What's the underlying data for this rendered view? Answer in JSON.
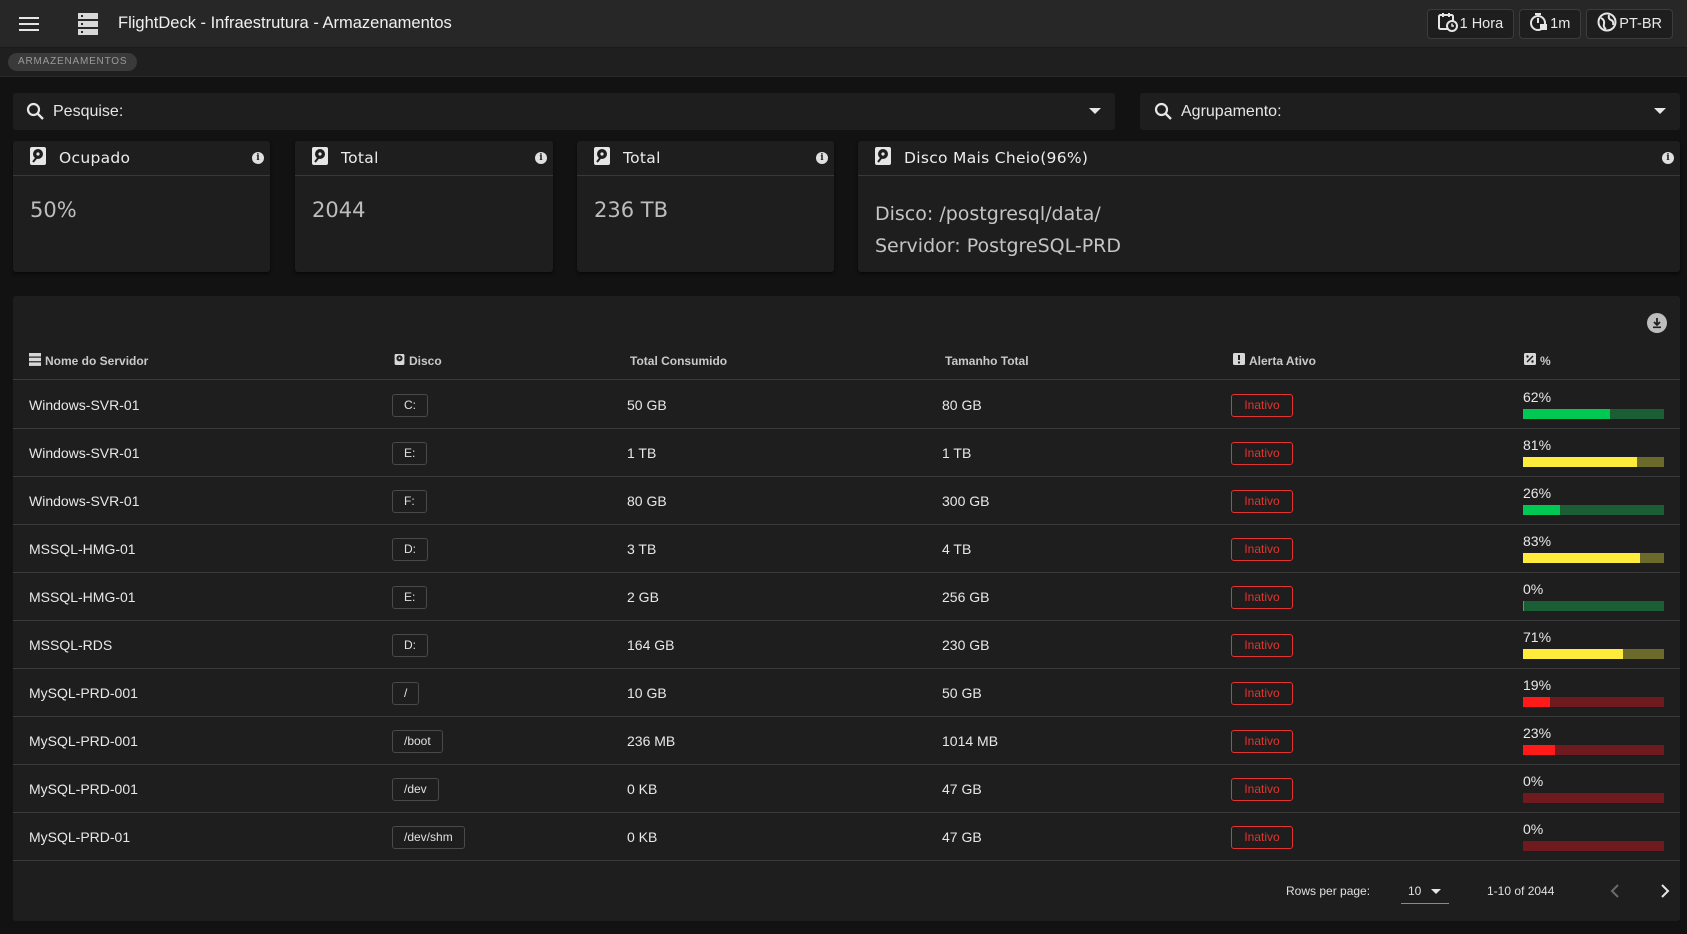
{
  "topbar": {
    "title": "FlightDeck - Infraestrutura - Armazenamentos",
    "time_range": "1 Hora",
    "refresh": "1m",
    "language": "PT-BR"
  },
  "breadcrumb": {
    "chip": "ARMAZENAMENTOS"
  },
  "filters": {
    "search_label": "Pesquise:",
    "group_label": "Agrupamento:"
  },
  "cards": [
    {
      "title": "Ocupado",
      "value": "50%"
    },
    {
      "title": "Total",
      "value": "2044"
    },
    {
      "title": "Total",
      "value": "236 TB"
    },
    {
      "title": "Disco Mais Cheio(96%)",
      "line1": "Disco: /postgresql/data/",
      "line2": "Servidor: PostgreSQL-PRD"
    }
  ],
  "table": {
    "headers": {
      "server": "Nome do Servidor",
      "disk": "Disco",
      "consumed": "Total Consumido",
      "size": "Tamanho Total",
      "alert": "Alerta Ativo",
      "pct": "%"
    },
    "rows": [
      {
        "server": "Windows-SVR-01",
        "disk": "C:",
        "consumed": "50 GB",
        "size": "80 GB",
        "alert": "Inativo",
        "pct_label": "62%",
        "pct": 62,
        "color": "green"
      },
      {
        "server": "Windows-SVR-01",
        "disk": "E:",
        "consumed": "1 TB",
        "size": "1 TB",
        "alert": "Inativo",
        "pct_label": "81%",
        "pct": 81,
        "color": "yellow"
      },
      {
        "server": "Windows-SVR-01",
        "disk": "F:",
        "consumed": "80 GB",
        "size": "300 GB",
        "alert": "Inativo",
        "pct_label": "26%",
        "pct": 26,
        "color": "green"
      },
      {
        "server": "MSSQL-HMG-01",
        "disk": "D:",
        "consumed": "3 TB",
        "size": "4 TB",
        "alert": "Inativo",
        "pct_label": "83%",
        "pct": 83,
        "color": "yellow"
      },
      {
        "server": "MSSQL-HMG-01",
        "disk": "E:",
        "consumed": "2 GB",
        "size": "256 GB",
        "alert": "Inativo",
        "pct_label": "0%",
        "pct": 0,
        "color": "green"
      },
      {
        "server": "MSSQL-RDS",
        "disk": "D:",
        "consumed": "164 GB",
        "size": "230 GB",
        "alert": "Inativo",
        "pct_label": "71%",
        "pct": 71,
        "color": "yellow"
      },
      {
        "server": "MySQL-PRD-001",
        "disk": "/",
        "consumed": "10 GB",
        "size": "50 GB",
        "alert": "Inativo",
        "pct_label": "19%",
        "pct": 19,
        "color": "red"
      },
      {
        "server": "MySQL-PRD-001",
        "disk": "/boot",
        "consumed": "236 MB",
        "size": "1014 MB",
        "alert": "Inativo",
        "pct_label": "23%",
        "pct": 23,
        "color": "red"
      },
      {
        "server": "MySQL-PRD-001",
        "disk": "/dev",
        "consumed": "0 KB",
        "size": "47 GB",
        "alert": "Inativo",
        "pct_label": "0%",
        "pct": 0,
        "color": "red"
      },
      {
        "server": "MySQL-PRD-01",
        "disk": "/dev/shm",
        "consumed": "0 KB",
        "size": "47 GB",
        "alert": "Inativo",
        "pct_label": "0%",
        "pct": 0,
        "color": "red"
      }
    ]
  },
  "pagination": {
    "rows_per_page_label": "Rows per page:",
    "rows_per_page": "10",
    "range": "1-10 of 2044"
  },
  "colors": {
    "green": {
      "fill": "#00c853",
      "track": "#1b5e35"
    },
    "yellow": {
      "fill": "#ffeb3b",
      "track": "#6b6a2a"
    },
    "red": {
      "fill": "#ff1a1a",
      "track": "#6e1a1f"
    }
  }
}
